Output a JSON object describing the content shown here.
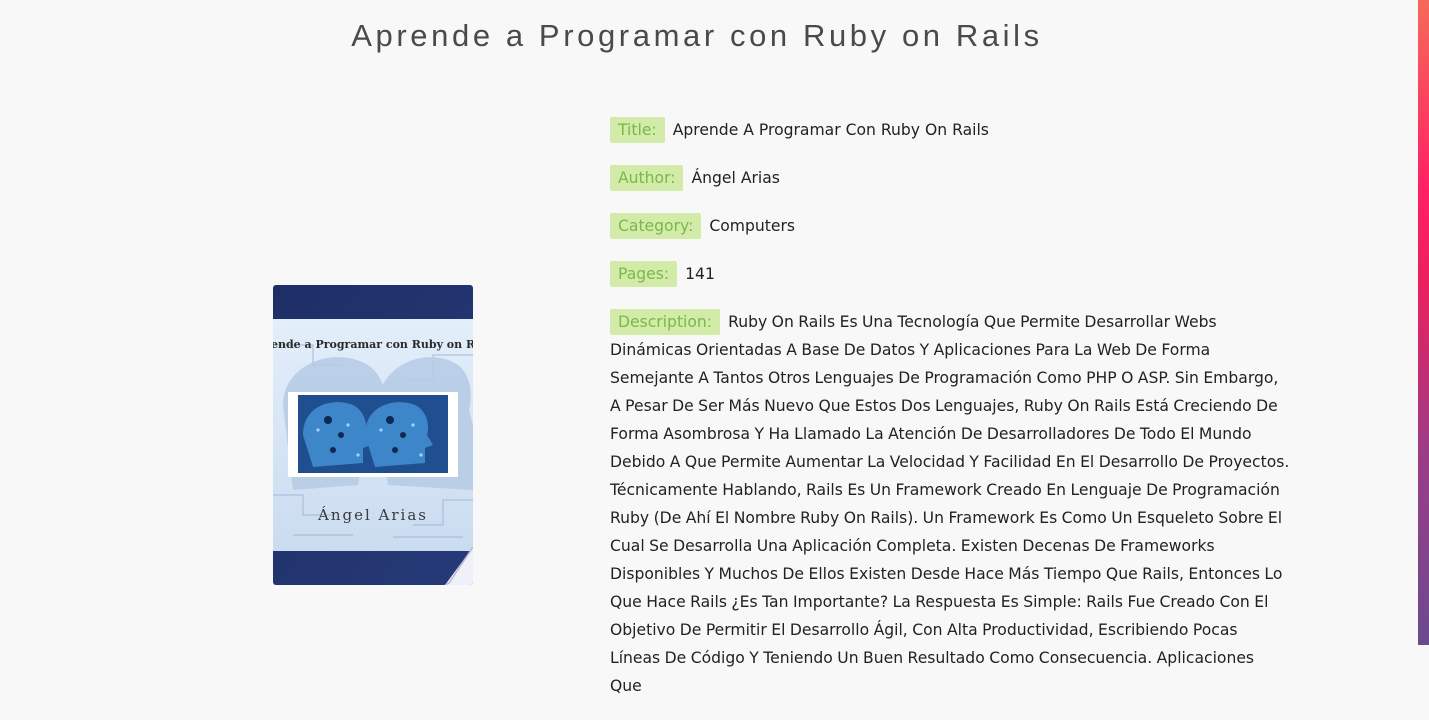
{
  "page": {
    "title": "Aprende a Programar con Ruby on Rails"
  },
  "cover": {
    "title_text": "Aprende a Programar con Ruby on Rails",
    "author_text": "Ángel Arias"
  },
  "details": {
    "title": {
      "label": "Title:",
      "value": "Aprende A Programar Con Ruby On Rails"
    },
    "author": {
      "label": "Author:",
      "value": "Ángel Arias"
    },
    "category": {
      "label": "Category:",
      "value": "Computers"
    },
    "pages": {
      "label": "Pages:",
      "value": "141"
    },
    "description": {
      "label": "Description:",
      "value": "Ruby On Rails Es Una Tecnología Que Permite Desarrollar Webs Dinámicas Orientadas A Base De Datos Y Aplicaciones Para La Web De Forma Semejante A Tantos Otros Lenguajes De Programación Como PHP O ASP. Sin Embargo, A Pesar De Ser Más Nuevo Que Estos Dos Lenguajes, Ruby On Rails Está Creciendo De Forma Asombrosa Y Ha Llamado La Atención De Desarrolladores De Todo El Mundo Debido A Que Permite Aumentar La Velocidad Y Facilidad En El Desarrollo De Proyectos. Técnicamente Hablando, Rails Es Un Framework Creado En Lenguaje De Programación Ruby (De Ahí El Nombre Ruby On Rails). Un Framework Es Como Un Esqueleto Sobre El Cual Se Desarrolla Una Aplicación Completa. Existen Decenas De Frameworks Disponibles Y Muchos De Ellos Existen Desde Hace Más Tiempo Que Rails, Entonces Lo Que Hace Rails ¿Es Tan Importante? La Respuesta Es Simple: Rails Fue Creado Con El Objetivo De Permitir El Desarrollo Ágil, Con Alta Productividad, Escribiendo Pocas Líneas De Código Y Teniendo Un Buen Resultado Como Consecuencia. Aplicaciones Que"
    }
  },
  "colors": {
    "tag_background": "#d2eba8",
    "tag_text": "#7ab84a",
    "page_background": "#f8f8f8",
    "cover_navy": "#1e2f66"
  }
}
